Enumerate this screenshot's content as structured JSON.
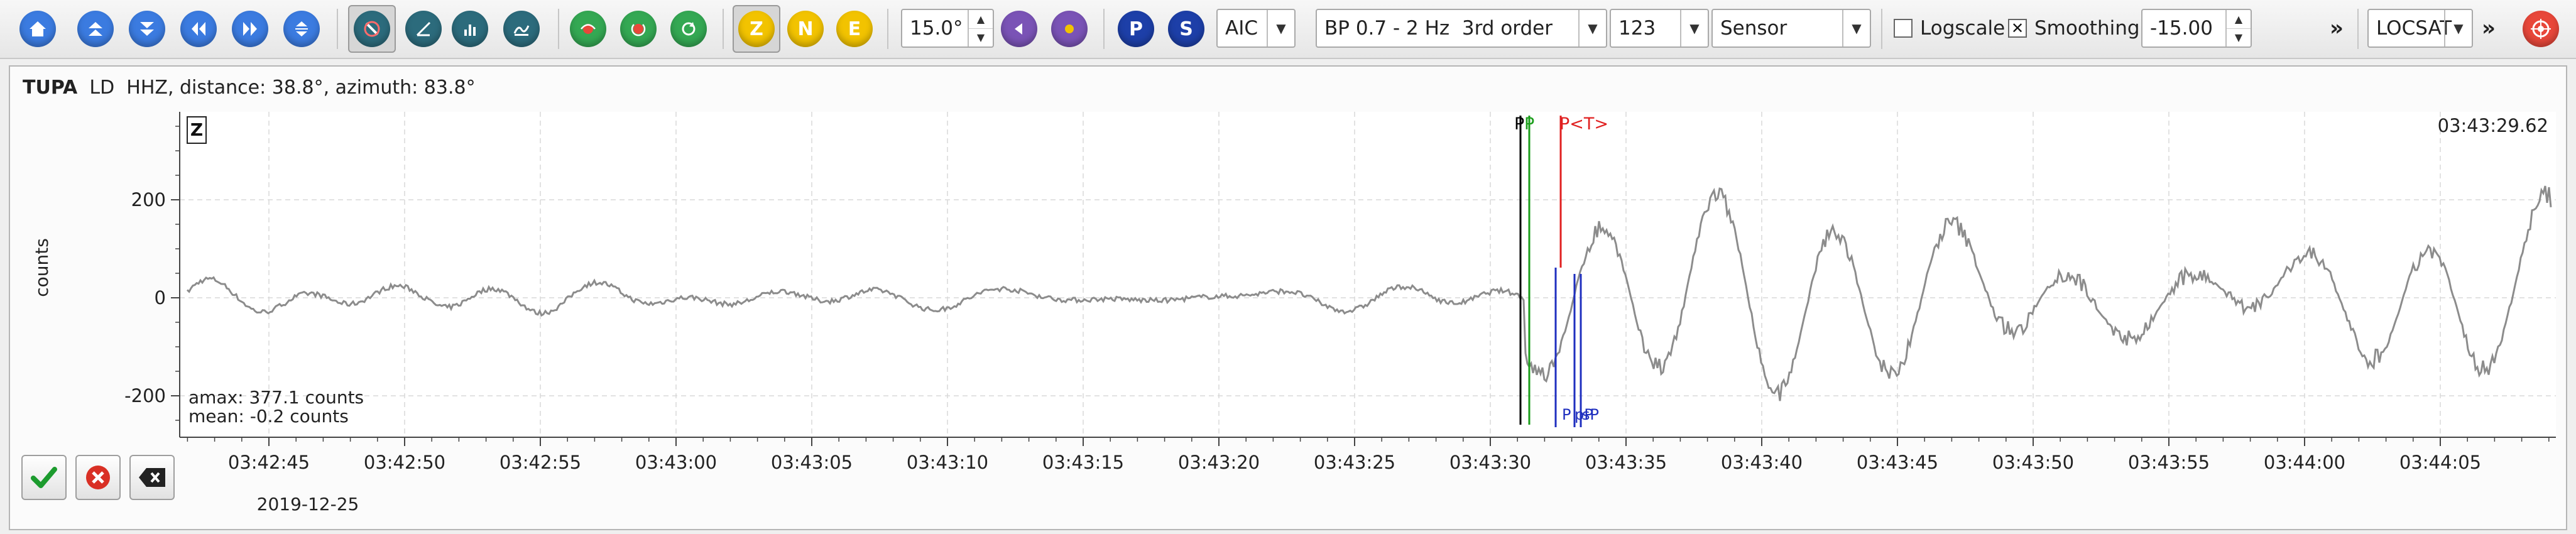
{
  "toolbar": {
    "nav_icons": [
      "home-icon",
      "scroll-up-icon",
      "scroll-down-icon",
      "scroll-left-icon",
      "scroll-right-icon",
      "align-icon"
    ],
    "tool_icons": [
      "pick-mode-icon",
      "measure-icon",
      "spectrum-icon",
      "spectrogram-icon"
    ],
    "filter_icons": [
      "filter-toggle-icon",
      "reset-icon",
      "refresh-icon"
    ],
    "component_buttons": [
      {
        "label": "Z",
        "name": "component-z-button",
        "pressed": true
      },
      {
        "label": "N",
        "name": "component-n-button",
        "pressed": false
      },
      {
        "label": "E",
        "name": "component-e-button",
        "pressed": false
      }
    ],
    "colors": {
      "blue": "#2f6fd6",
      "green": "#34a853",
      "yellow": "#f2c300",
      "purple": "#7a53b6",
      "dark_blue": "#1d3fa8",
      "red": "#e8473a"
    },
    "angle_value": "15.0°",
    "pick_buttons": [
      {
        "label": "P",
        "name": "pick-p-button"
      },
      {
        "label": "S",
        "name": "pick-s-button"
      }
    ],
    "picker_method": "AIC",
    "filter": "BP 0.7 - 2 Hz  3rd order",
    "rotation": "123",
    "unit": "Sensor",
    "logscale_label": "Logscale",
    "logscale_checked": false,
    "smoothing_label": "Smoothing",
    "smoothing_checked": true,
    "offset_value": "-15.00",
    "more_glyph": "»",
    "locator": "LOCSAT",
    "more_glyph_2": "»",
    "end_icon": "target-icon"
  },
  "trace": {
    "station": "TUPA",
    "location": "LD",
    "channel": "HHZ",
    "distance_label": "distance: 38.8°",
    "azimuth_label": "azimuth: 83.8°",
    "component_badge": "Z",
    "y_axis_label": "counts",
    "y_ticks": [
      "200",
      "0",
      "-200"
    ],
    "time_readout": "03:43:29.62",
    "amax": "amax: 377.1 counts",
    "mean": "mean: -0.2 counts",
    "x_ticks": [
      "03:42:45",
      "03:42:50",
      "03:42:55",
      "03:43:00",
      "03:43:05",
      "03:43:10",
      "03:43:15",
      "03:43:20",
      "03:43:25",
      "03:43:30",
      "03:43:35",
      "03:43:40",
      "03:43:45",
      "03:43:50",
      "03:43:55",
      "03:44:00",
      "03:44:05"
    ],
    "date": "2019-12-25",
    "picks_top": [
      {
        "label": "P",
        "color": "#000000"
      },
      {
        "label": "P",
        "color": "#1b9e1b"
      },
      {
        "label": "P<T>",
        "color": "#e02020"
      }
    ],
    "picks_bottom": [
      {
        "label": "P",
        "color": "#1f2fbf"
      },
      {
        "label": "pP",
        "color": "#1f2fbf"
      },
      {
        "label": "sP",
        "color": "#1f2fbf"
      }
    ]
  },
  "bottom_buttons": [
    "accept-icon",
    "reject-icon",
    "delete-icon"
  ]
}
